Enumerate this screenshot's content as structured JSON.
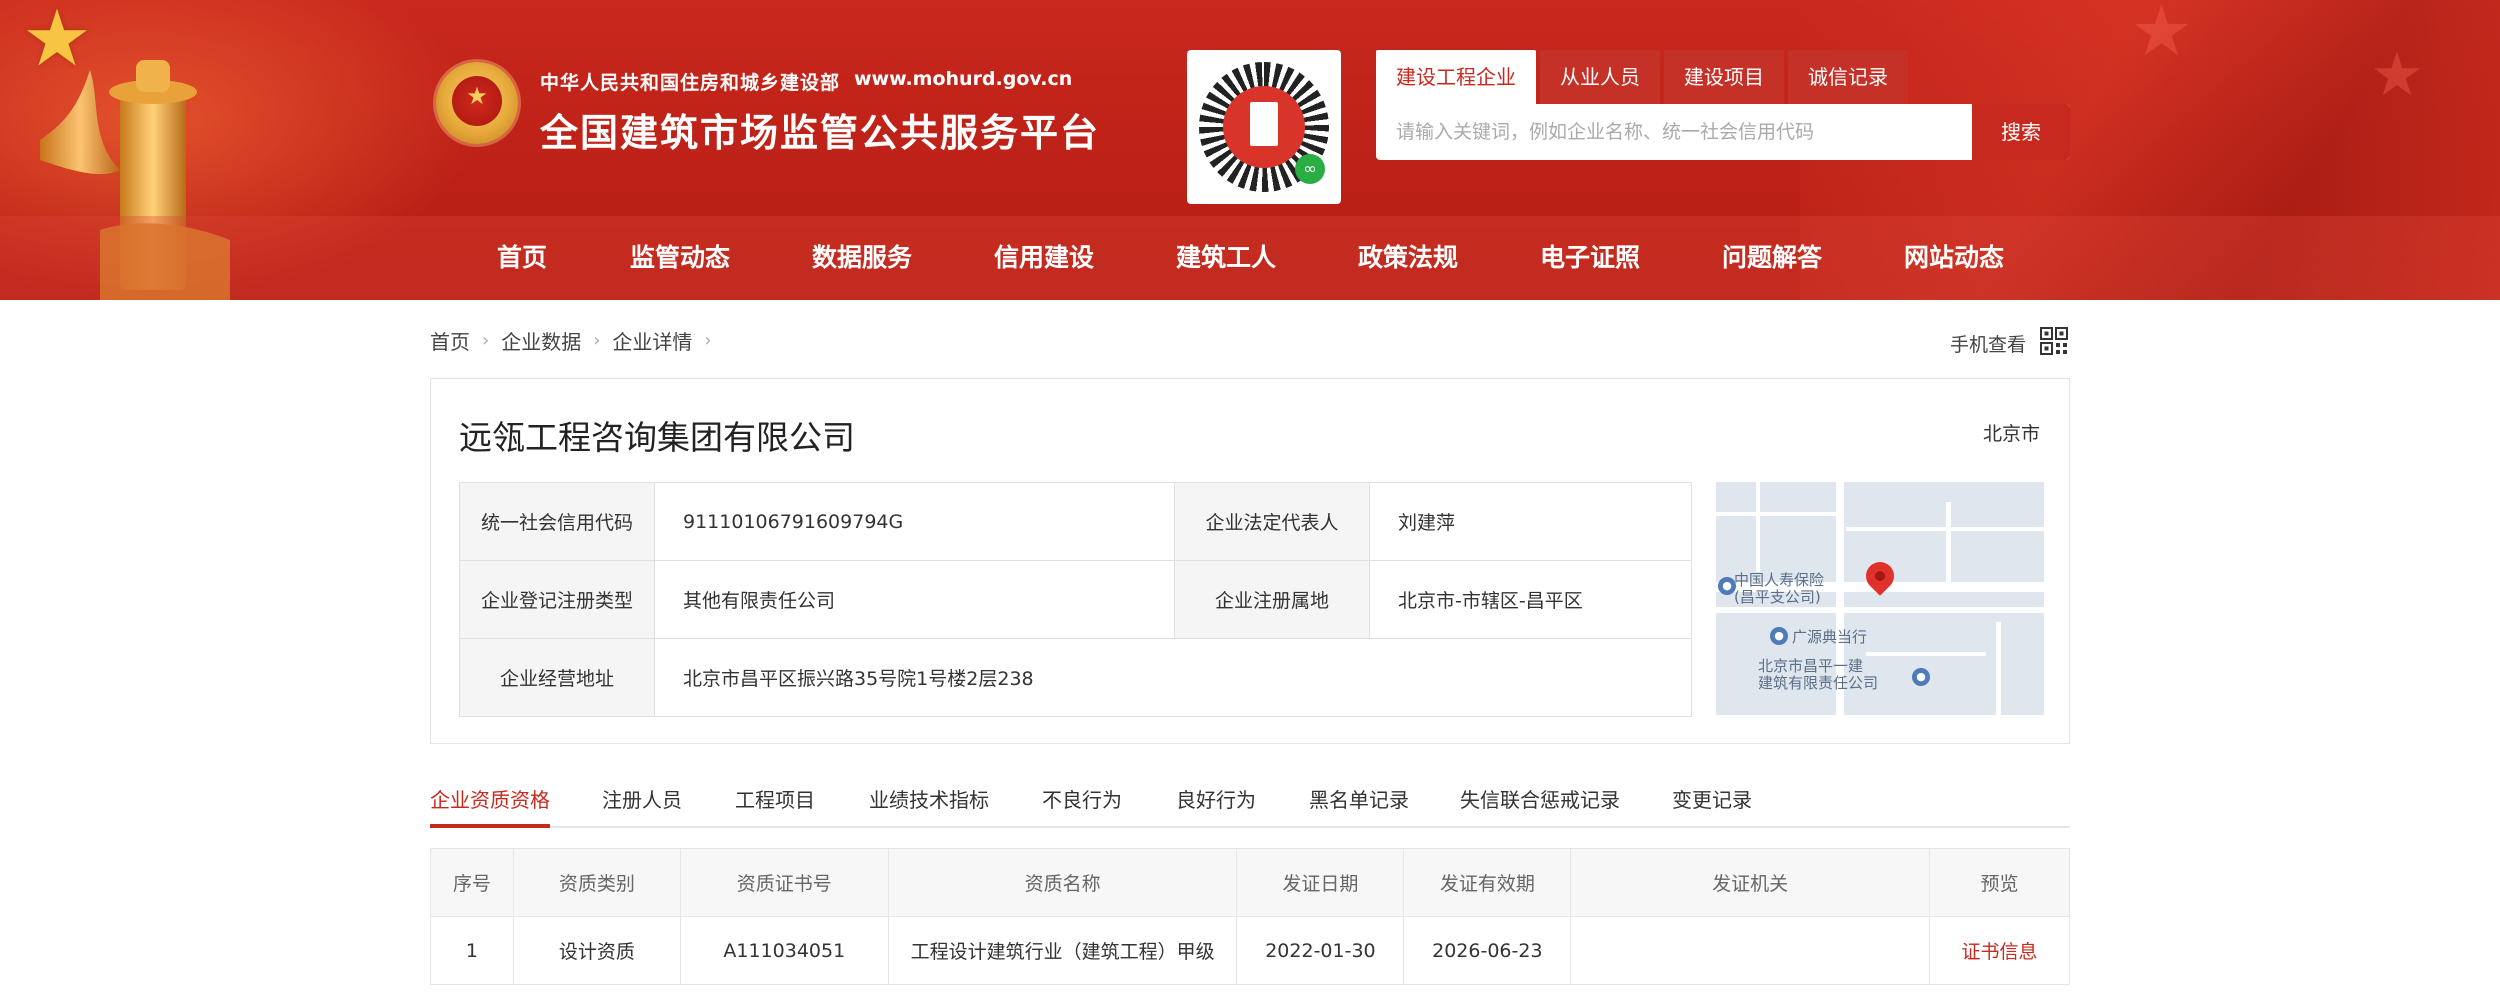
{
  "header": {
    "ministry": "中华人民共和国住房和城乡建设部",
    "url": "www.mohurd.gov.cn",
    "platform_title": "全国建筑市场监管公共服务平台",
    "colors": {
      "primary": "#c8291e",
      "star": "#f7c542"
    }
  },
  "search": {
    "tabs": [
      "建设工程企业",
      "从业人员",
      "建设项目",
      "诚信记录"
    ],
    "active_tab": "建设工程企业",
    "placeholder": "请输入关键词，例如企业名称、统一社会信用代码",
    "button": "搜索"
  },
  "nav": {
    "items": [
      "首页",
      "监管动态",
      "数据服务",
      "信用建设",
      "建筑工人",
      "政策法规",
      "电子证照",
      "问题解答",
      "网站动态"
    ]
  },
  "breadcrumb": [
    "首页",
    "企业数据",
    "企业详情"
  ],
  "mobile_view": "手机查看",
  "company": {
    "name": "远瓴工程咨询集团有限公司",
    "city": "北京市",
    "fields": {
      "credit_code_label": "统一社会信用代码",
      "credit_code": "91110106791609794G",
      "legal_rep_label": "企业法定代表人",
      "legal_rep": "刘建萍",
      "reg_type_label": "企业登记注册类型",
      "reg_type": "其他有限责任公司",
      "reg_place_label": "企业注册属地",
      "reg_place": "北京市-市辖区-昌平区",
      "address_label": "企业经营地址",
      "address": "北京市昌平区振兴路35号院1号楼2层238"
    },
    "map_labels": {
      "poi1": "中国人寿保险\n(昌平支公司)",
      "poi2": "广源典当行",
      "poi3": "北京市昌平一建\n建筑有限责任公司"
    }
  },
  "tabs": [
    "企业资质资格",
    "注册人员",
    "工程项目",
    "业绩技术指标",
    "不良行为",
    "良好行为",
    "黑名单记录",
    "失信联合惩戒记录",
    "变更记录"
  ],
  "active_tab": "企业资质资格",
  "qualifications": {
    "columns": [
      "序号",
      "资质类别",
      "资质证书号",
      "资质名称",
      "发证日期",
      "发证有效期",
      "发证机关",
      "预览"
    ],
    "rows": [
      [
        "1",
        "设计资质",
        "A111034051",
        "工程设计建筑行业（建筑工程）甲级",
        "2022-01-30",
        "2026-06-23",
        "",
        "证书信息"
      ]
    ]
  }
}
